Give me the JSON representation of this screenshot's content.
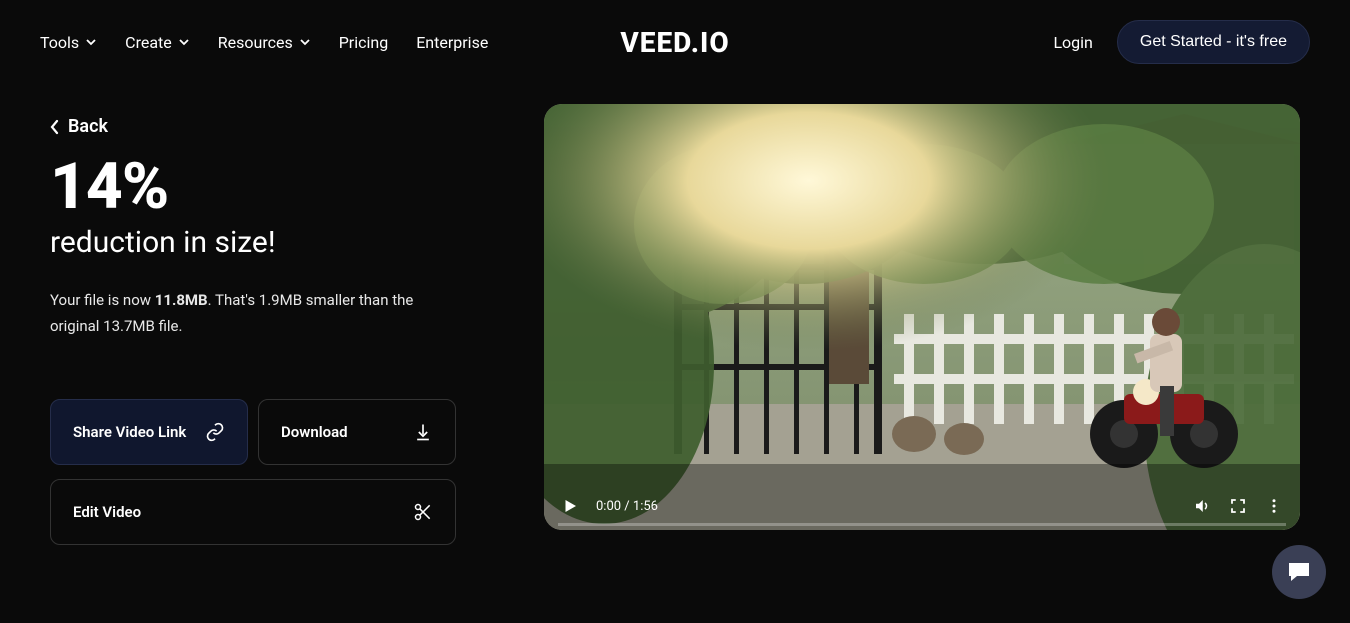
{
  "header": {
    "nav": [
      "Tools",
      "Create",
      "Resources",
      "Pricing",
      "Enterprise"
    ],
    "nav_has_dropdown": [
      true,
      true,
      true,
      false,
      false
    ],
    "logo": "VEED.IO",
    "login": "Login",
    "cta": "Get Started - it's free"
  },
  "page": {
    "back": "Back",
    "percent": "14%",
    "subtitle": "reduction in size!",
    "desc_pre": "Your file is now ",
    "desc_bold": "11.8MB",
    "desc_post": ". That's 1.9MB smaller than the original 13.7MB file.",
    "share_btn": "Share Video Link",
    "download_btn": "Download",
    "edit_btn": "Edit Video"
  },
  "video": {
    "current_time": "0:00",
    "duration": "1:56"
  }
}
